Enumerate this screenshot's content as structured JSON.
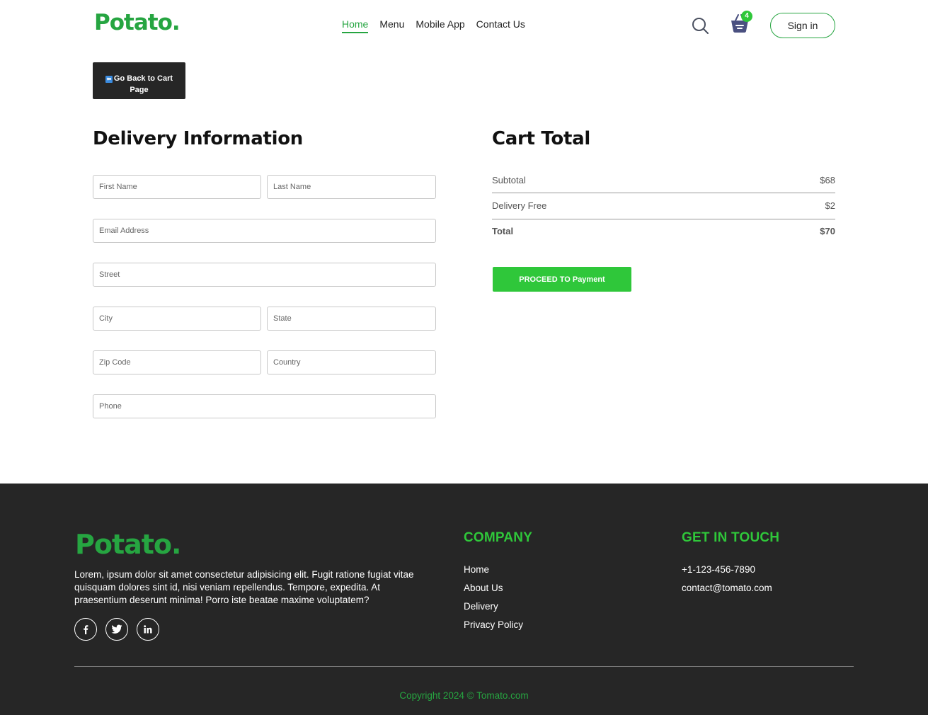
{
  "navbar": {
    "logo": "Potato.",
    "links": [
      "Home",
      "Menu",
      "Mobile App",
      "Contact Us"
    ],
    "cart_count": "4",
    "signin_label": "Sign in"
  },
  "back_button": {
    "label_line1": "Go Back to Cart",
    "label_line2": "Page"
  },
  "delivery": {
    "title": "Delivery Information",
    "placeholders": {
      "first_name": "First Name",
      "last_name": "Last Name",
      "email": "Email Address",
      "street": "Street",
      "city": "City",
      "state": "State",
      "zip": "Zip Code",
      "country": "Country",
      "phone": "Phone"
    }
  },
  "cart_total": {
    "title": "Cart Total",
    "subtotal_label": "Subtotal",
    "subtotal_value": "$68",
    "delivery_label": "Delivery Free",
    "delivery_value": "$2",
    "total_label": "Total",
    "total_value": "$70",
    "proceed_label": "PROCEED TO Payment"
  },
  "footer": {
    "logo": "Potato.",
    "description": "Lorem, ipsum dolor sit amet consectetur adipisicing elit. Fugit ratione fugiat vitae quisquam dolores sint id, nisi veniam repellendus. Tempore, expedita. At praesentium deserunt minima! Porro iste beatae maxime voluptatem?",
    "company_heading": "COMPANY",
    "company_links": [
      "Home",
      "About Us",
      "Delivery",
      "Privacy Policy"
    ],
    "contact_heading": "GET IN TOUCH",
    "phone": "+1-123-456-7890",
    "email": "contact@tomato.com",
    "copyright": "Copyright 2024 © Tomato.com",
    "social": [
      "facebook-icon",
      "twitter-icon",
      "linkedin-icon"
    ]
  },
  "colors": {
    "brand_green": "#26a541",
    "accent_green": "#2fc73a",
    "dark": "#262626"
  }
}
